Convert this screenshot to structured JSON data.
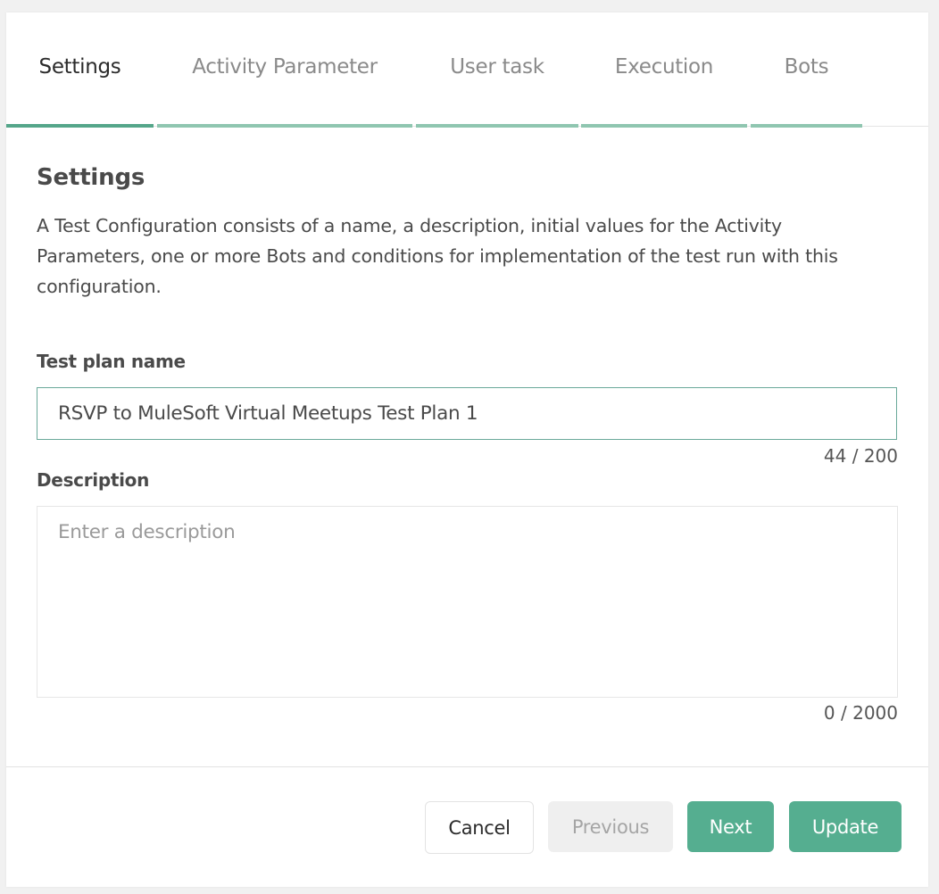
{
  "tabs": [
    {
      "label": "Settings",
      "active": true
    },
    {
      "label": "Activity Parameter",
      "active": false
    },
    {
      "label": "User task",
      "active": false
    },
    {
      "label": "Execution",
      "active": false
    },
    {
      "label": "Bots",
      "active": false
    }
  ],
  "section": {
    "title": "Settings",
    "description": "A Test Configuration consists of a name, a description, initial values for the Activity Parameters, one or more Bots and conditions for implementation of the test run with this configuration."
  },
  "form": {
    "name_label": "Test plan name",
    "name_value": "RSVP to MuleSoft Virtual Meetups Test Plan 1",
    "name_counter": "44 / 200",
    "description_label": "Description",
    "description_value": "",
    "description_placeholder": "Enter a description",
    "description_counter": "0 / 2000"
  },
  "footer": {
    "cancel_label": "Cancel",
    "previous_label": "Previous",
    "next_label": "Next",
    "update_label": "Update"
  },
  "colors": {
    "accent": "#55ae90",
    "active_tab_bar": "#55a68a",
    "inactive_tab_bar": "#8fc6b0",
    "input_focus_border": "#6aa99a"
  }
}
